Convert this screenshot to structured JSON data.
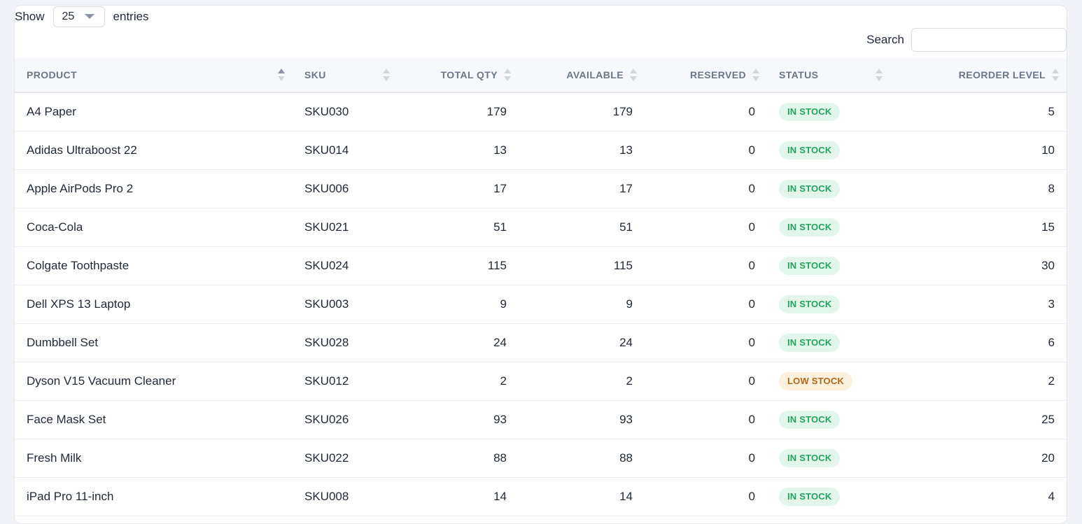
{
  "length_menu": {
    "show_label": "Show",
    "value": "25",
    "entries_label": "entries"
  },
  "search": {
    "label": "Search",
    "value": "",
    "placeholder": ""
  },
  "columns": {
    "product": "PRODUCT",
    "sku": "SKU",
    "total_qty": "TOTAL QTY",
    "available": "AVAILABLE",
    "reserved": "RESERVED",
    "status": "STATUS",
    "reorder_level": "REORDER LEVEL"
  },
  "sorted_column": "product",
  "sort_direction": "ascending",
  "colors": {
    "in_stock": "#22a55b",
    "low_stock": "#b4661a",
    "header_text": "#6b7689"
  },
  "rows": [
    {
      "product": "A4 Paper",
      "sku": "SKU030",
      "total_qty": "179",
      "available": "179",
      "reserved": "0",
      "status": "IN STOCK",
      "status_kind": "in",
      "reorder_level": "5"
    },
    {
      "product": "Adidas Ultraboost 22",
      "sku": "SKU014",
      "total_qty": "13",
      "available": "13",
      "reserved": "0",
      "status": "IN STOCK",
      "status_kind": "in",
      "reorder_level": "10"
    },
    {
      "product": "Apple AirPods Pro 2",
      "sku": "SKU006",
      "total_qty": "17",
      "available": "17",
      "reserved": "0",
      "status": "IN STOCK",
      "status_kind": "in",
      "reorder_level": "8"
    },
    {
      "product": "Coca-Cola",
      "sku": "SKU021",
      "total_qty": "51",
      "available": "51",
      "reserved": "0",
      "status": "IN STOCK",
      "status_kind": "in",
      "reorder_level": "15"
    },
    {
      "product": "Colgate Toothpaste",
      "sku": "SKU024",
      "total_qty": "115",
      "available": "115",
      "reserved": "0",
      "status": "IN STOCK",
      "status_kind": "in",
      "reorder_level": "30"
    },
    {
      "product": "Dell XPS 13 Laptop",
      "sku": "SKU003",
      "total_qty": "9",
      "available": "9",
      "reserved": "0",
      "status": "IN STOCK",
      "status_kind": "in",
      "reorder_level": "3"
    },
    {
      "product": "Dumbbell Set",
      "sku": "SKU028",
      "total_qty": "24",
      "available": "24",
      "reserved": "0",
      "status": "IN STOCK",
      "status_kind": "in",
      "reorder_level": "6"
    },
    {
      "product": "Dyson V15 Vacuum Cleaner",
      "sku": "SKU012",
      "total_qty": "2",
      "available": "2",
      "reserved": "0",
      "status": "LOW STOCK",
      "status_kind": "low",
      "reorder_level": "2"
    },
    {
      "product": "Face Mask Set",
      "sku": "SKU026",
      "total_qty": "93",
      "available": "93",
      "reserved": "0",
      "status": "IN STOCK",
      "status_kind": "in",
      "reorder_level": "25"
    },
    {
      "product": "Fresh Milk",
      "sku": "SKU022",
      "total_qty": "88",
      "available": "88",
      "reserved": "0",
      "status": "IN STOCK",
      "status_kind": "in",
      "reorder_level": "20"
    },
    {
      "product": "iPad Pro 11-inch",
      "sku": "SKU008",
      "total_qty": "14",
      "available": "14",
      "reserved": "0",
      "status": "IN STOCK",
      "status_kind": "in",
      "reorder_level": "4"
    }
  ]
}
